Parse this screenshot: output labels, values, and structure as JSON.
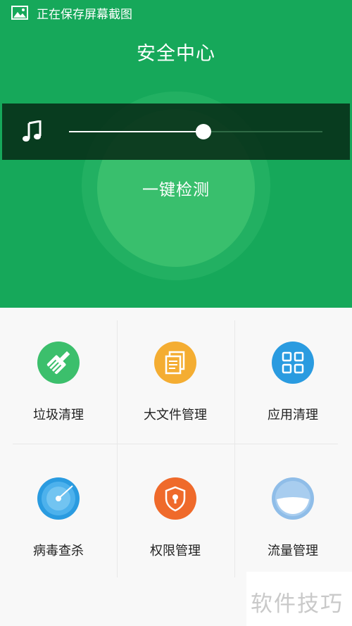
{
  "status_bar": {
    "text": "正在保存屏幕截图",
    "icon": "image-icon"
  },
  "header": {
    "title": "安全中心",
    "scan_button_label": "一键检测",
    "color": "#16a85a"
  },
  "volume_panel": {
    "icon": "music-note-icon",
    "level": 0.53
  },
  "tools": [
    {
      "label": "垃圾清理",
      "icon": "broom-icon",
      "color": "#3cbf6c"
    },
    {
      "label": "大文件管理",
      "icon": "document-icon",
      "color": "#f4ad32"
    },
    {
      "label": "应用清理",
      "icon": "apps-grid-icon",
      "color": "#2a9be0"
    },
    {
      "label": "病毒查杀",
      "icon": "radar-icon",
      "color": "#2a9be0"
    },
    {
      "label": "权限管理",
      "icon": "shield-lock-icon",
      "color": "#ef6a2b"
    },
    {
      "label": "流量管理",
      "icon": "data-bowl-icon",
      "color": "#8fbde8"
    }
  ],
  "watermark": {
    "text": "软件技巧"
  }
}
